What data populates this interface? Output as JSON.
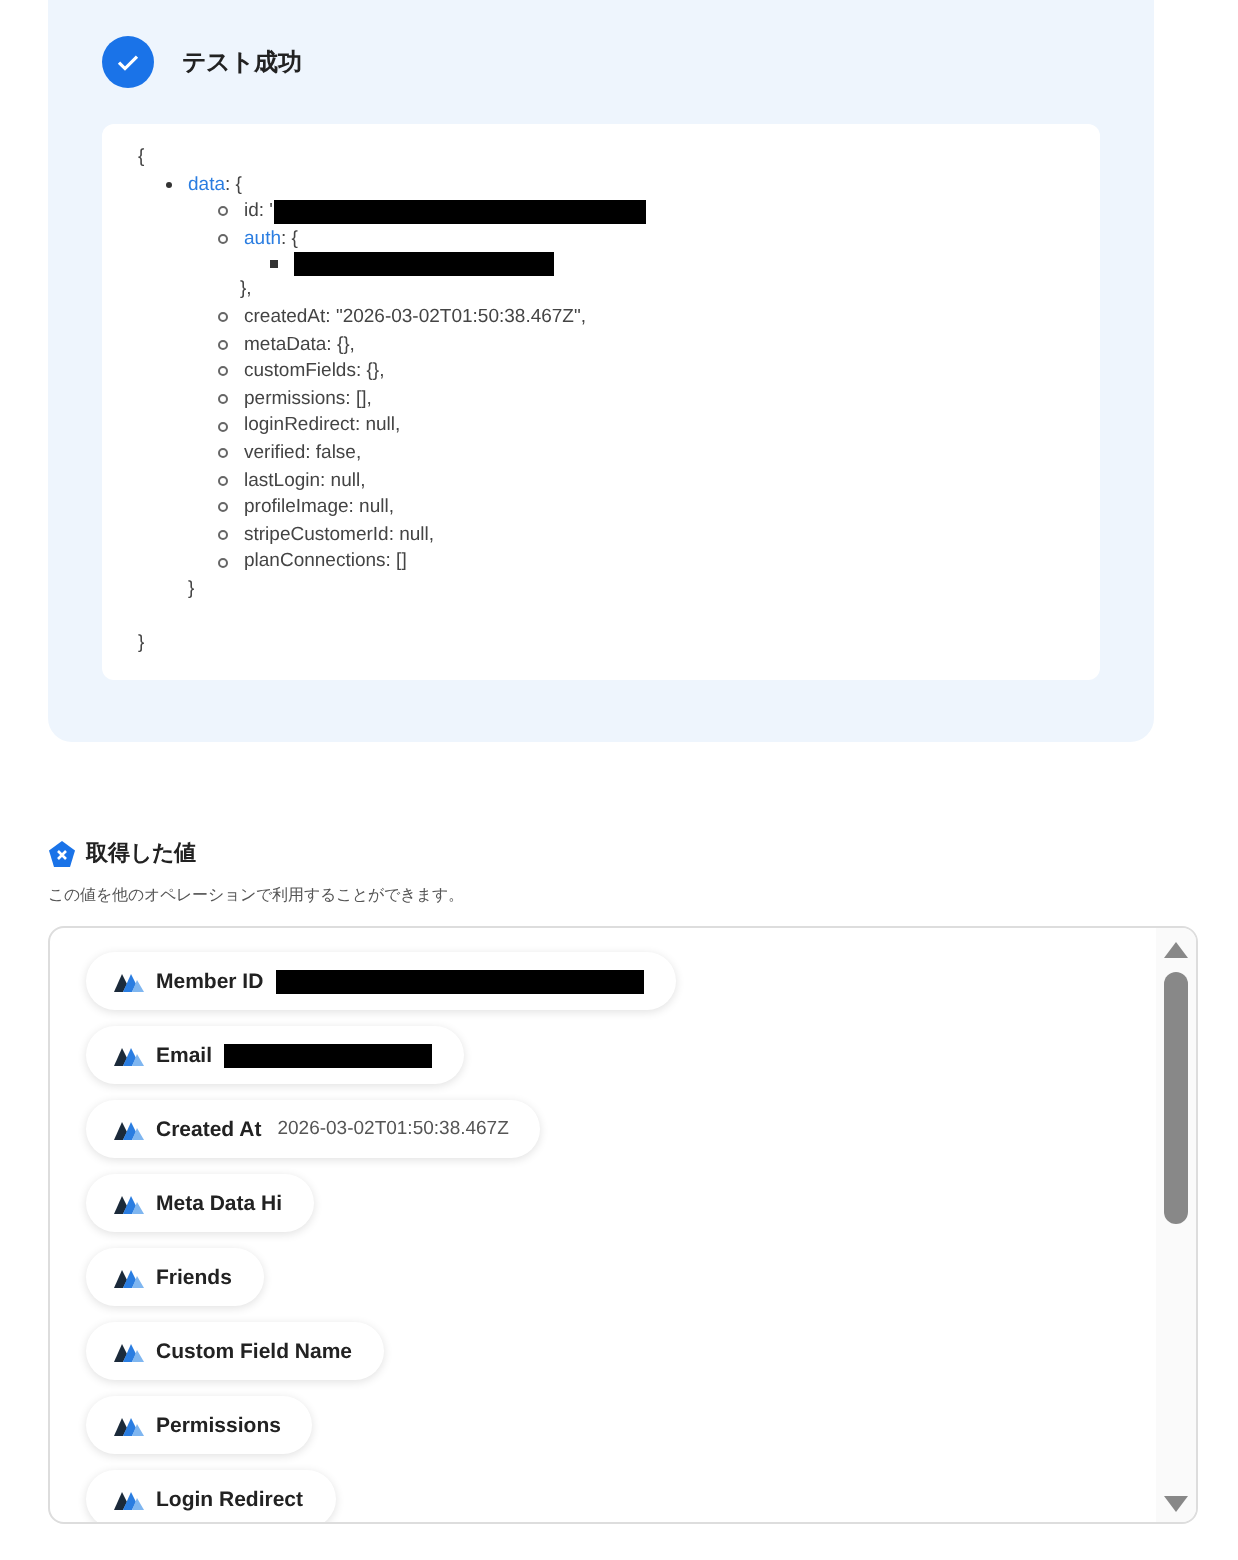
{
  "result": {
    "title": "テスト成功",
    "code": {
      "open": "{",
      "close": "}",
      "children": [
        {
          "key": "data",
          "text": ": {",
          "close": "}",
          "children": [
            {
              "text": "id: '",
              "redacted": true
            },
            {
              "key": "auth",
              "text": ": {",
              "close": "},",
              "children": [
                {
                  "redacted": true
                }
              ]
            },
            {
              "text": "createdAt: \"2026-03-02T01:50:38.467Z\","
            },
            {
              "text": "metaData: {},"
            },
            {
              "text": "customFields: {},"
            },
            {
              "text": "permissions: [],"
            },
            {
              "text": "loginRedirect: null,"
            },
            {
              "text": "verified: false,"
            },
            {
              "text": "lastLogin: null,"
            },
            {
              "text": "profileImage: null,"
            },
            {
              "text": "stripeCustomerId: null,"
            },
            {
              "text": "planConnections: []"
            }
          ]
        }
      ]
    }
  },
  "values": {
    "title": "取得した値",
    "description": "この値を他のオペレーションで利用することができます。",
    "items": [
      {
        "label": "Member ID",
        "redacted": true
      },
      {
        "label": "Email",
        "redacted": true
      },
      {
        "label": "Created At",
        "value": "2026-03-02T01:50:38.467Z"
      },
      {
        "label": "Meta Data Hi"
      },
      {
        "label": "Friends"
      },
      {
        "label": "Custom Field Name"
      },
      {
        "label": "Permissions"
      },
      {
        "label": "Login Redirect"
      }
    ]
  }
}
